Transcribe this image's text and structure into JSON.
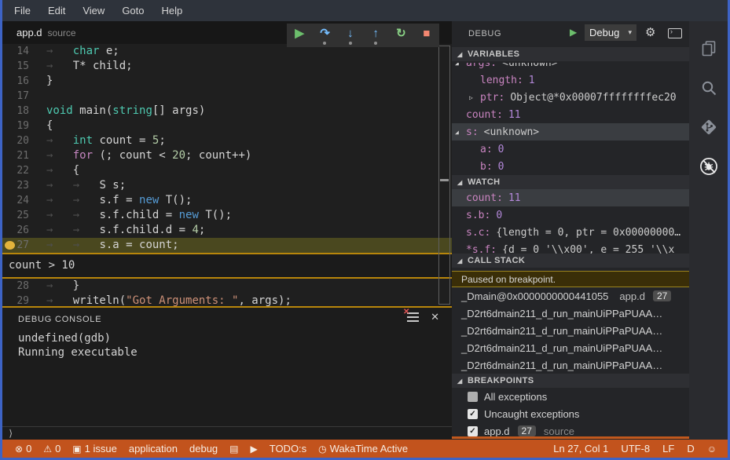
{
  "colors": {
    "window_border": "#3D63C5",
    "statusbar_bg": "#C2531D",
    "accent_orange": "#B8860B",
    "breakpoint_gold": "#E3B33C",
    "line_highlight_bg": "#4A481F",
    "keyword_type": "#4EC9B0",
    "keyword_control": "#C586C0",
    "keyword_new": "#569CD6",
    "number": "#B5CEA8",
    "string": "#CE9178",
    "variable_name": "#C984C0",
    "variable_number": "#B388D9"
  },
  "icons": {
    "expanded": "◢",
    "collapsed": "▷",
    "dropdown": "▾",
    "gear": "⚙",
    "close": "✕",
    "clear_x": "✕",
    "play": "▶",
    "prompt": "⟩",
    "term_chevron": "›"
  },
  "menu": {
    "items": [
      "File",
      "Edit",
      "View",
      "Goto",
      "Help"
    ]
  },
  "tab": {
    "file": "app.d",
    "hint": "source"
  },
  "debug_toolbar": {
    "buttons": [
      {
        "name": "continue",
        "glyph": "▶",
        "color": "#6CBE6C",
        "dot": false
      },
      {
        "name": "step-over",
        "glyph": "↷",
        "color": "#75BEFF",
        "dot": true
      },
      {
        "name": "step-into",
        "glyph": "↓",
        "color": "#75BEFF",
        "dot": true
      },
      {
        "name": "step-out",
        "glyph": "↑",
        "color": "#75BEFF",
        "dot": true
      },
      {
        "name": "restart",
        "glyph": "↻",
        "color": "#89D185",
        "dot": false
      },
      {
        "name": "stop",
        "glyph": "■",
        "color": "#F48771",
        "dot": false
      }
    ]
  },
  "editor": {
    "condition": "count > 10",
    "lines": [
      {
        "num": "14",
        "segs": [
          {
            "c": "ws",
            "t": "→   "
          },
          {
            "c": "type",
            "t": "char"
          },
          {
            "c": "def",
            "t": " e;"
          }
        ]
      },
      {
        "num": "15",
        "segs": [
          {
            "c": "ws",
            "t": "→   "
          },
          {
            "c": "def",
            "t": "T* child;"
          }
        ]
      },
      {
        "num": "16",
        "segs": [
          {
            "c": "def",
            "t": "}"
          }
        ]
      },
      {
        "num": "17",
        "segs": []
      },
      {
        "num": "18",
        "segs": [
          {
            "c": "type",
            "t": "void"
          },
          {
            "c": "def",
            "t": " main("
          },
          {
            "c": "type",
            "t": "string"
          },
          {
            "c": "def",
            "t": "[] args)"
          }
        ]
      },
      {
        "num": "19",
        "segs": [
          {
            "c": "def",
            "t": "{"
          }
        ]
      },
      {
        "num": "20",
        "segs": [
          {
            "c": "ws",
            "t": "→   "
          },
          {
            "c": "type",
            "t": "int"
          },
          {
            "c": "def",
            "t": " count = "
          },
          {
            "c": "num",
            "t": "5"
          },
          {
            "c": "def",
            "t": ";"
          }
        ]
      },
      {
        "num": "21",
        "segs": [
          {
            "c": "ws",
            "t": "→   "
          },
          {
            "c": "ctrl",
            "t": "for"
          },
          {
            "c": "def",
            "t": " (; count < "
          },
          {
            "c": "num",
            "t": "20"
          },
          {
            "c": "def",
            "t": "; count++)"
          }
        ]
      },
      {
        "num": "22",
        "segs": [
          {
            "c": "ws",
            "t": "→   "
          },
          {
            "c": "def",
            "t": "{"
          }
        ]
      },
      {
        "num": "23",
        "segs": [
          {
            "c": "ws",
            "t": "→   "
          },
          {
            "c": "ws",
            "t": "→   "
          },
          {
            "c": "def",
            "t": "S s;"
          }
        ]
      },
      {
        "num": "24",
        "segs": [
          {
            "c": "ws",
            "t": "→   "
          },
          {
            "c": "ws",
            "t": "→   "
          },
          {
            "c": "def",
            "t": "s.f = "
          },
          {
            "c": "new",
            "t": "new"
          },
          {
            "c": "def",
            "t": " T();"
          }
        ]
      },
      {
        "num": "25",
        "segs": [
          {
            "c": "ws",
            "t": "→   "
          },
          {
            "c": "ws",
            "t": "→   "
          },
          {
            "c": "def",
            "t": "s.f.child = "
          },
          {
            "c": "new",
            "t": "new"
          },
          {
            "c": "def",
            "t": " T();"
          }
        ]
      },
      {
        "num": "26",
        "segs": [
          {
            "c": "ws",
            "t": "→   "
          },
          {
            "c": "ws",
            "t": "→   "
          },
          {
            "c": "def",
            "t": "s.f.child.d = "
          },
          {
            "c": "num",
            "t": "4"
          },
          {
            "c": "def",
            "t": ";"
          }
        ]
      },
      {
        "num": "27",
        "current": true,
        "breakpoint": true,
        "segs": [
          {
            "c": "ws",
            "t": "→   "
          },
          {
            "c": "ws",
            "t": "→   "
          },
          {
            "c": "def",
            "t": "s.a = count;"
          }
        ]
      },
      {
        "widget": true
      },
      {
        "num": "28",
        "segs": [
          {
            "c": "ws",
            "t": "→   "
          },
          {
            "c": "def",
            "t": "}"
          }
        ]
      },
      {
        "num": "29",
        "segs": [
          {
            "c": "ws",
            "t": "→   "
          },
          {
            "c": "def",
            "t": "writeln("
          },
          {
            "c": "str",
            "t": "\"Got Arguments: \""
          },
          {
            "c": "def",
            "t": ", args);"
          }
        ]
      }
    ]
  },
  "console": {
    "title": "DEBUG CONSOLE",
    "lines": [
      "undefined(gdb)",
      "Running executable"
    ],
    "prompt": "⟩"
  },
  "sidebar": {
    "title": "DEBUG",
    "config": "Debug",
    "variables": {
      "label": "VARIABLES",
      "rows": [
        {
          "indent": 0,
          "arrow": "expanded",
          "name": "args",
          "value": "<unknown>",
          "vtype": "text",
          "clipped": true
        },
        {
          "indent": 1,
          "name": "length",
          "value": "1",
          "vtype": "num"
        },
        {
          "indent": 1,
          "arrow": "collapsed",
          "name": "ptr",
          "value": "Object@*0x00007ffffffffec20",
          "vtype": "text"
        },
        {
          "indent": 0,
          "name": "count",
          "value": "11",
          "vtype": "num"
        },
        {
          "indent": 0,
          "arrow": "expanded",
          "name": "s",
          "value": "<unknown>",
          "vtype": "text",
          "selected": true
        },
        {
          "indent": 1,
          "name": "a",
          "value": "0",
          "vtype": "num"
        },
        {
          "indent": 1,
          "name": "b",
          "value": "0",
          "vtype": "num"
        }
      ]
    },
    "watch": {
      "label": "WATCH",
      "rows": [
        {
          "indent": 0,
          "name": "count",
          "value": "11",
          "vtype": "num",
          "selected": true
        },
        {
          "indent": 0,
          "name": "s.b",
          "value": "0",
          "vtype": "num"
        },
        {
          "indent": 0,
          "name": "s.c",
          "value": "{length = 0, ptr = 0x00000000…",
          "vtype": "text"
        },
        {
          "indent": 0,
          "name": "*s.f",
          "value": "{d = 0 '\\\\x00', e = 255 '\\\\x",
          "vtype": "text"
        }
      ]
    },
    "call_stack": {
      "label": "CALL STACK",
      "status": "Paused on breakpoint.",
      "frames": [
        {
          "name": "_Dmain@0x0000000000441055",
          "file": "app.d",
          "line": "27"
        },
        {
          "name": "_D2rt6dmain211_d_run_mainUiPPaPUAA…"
        },
        {
          "name": "_D2rt6dmain211_d_run_mainUiPPaPUAA…"
        },
        {
          "name": "_D2rt6dmain211_d_run_mainUiPPaPUAA…"
        },
        {
          "name": "_D2rt6dmain211_d_run_mainUiPPaPUAA…"
        }
      ]
    },
    "breakpoints": {
      "label": "BREAKPOINTS",
      "items": [
        {
          "checked": false,
          "label": "All exceptions"
        },
        {
          "checked": true,
          "label": "Uncaught exceptions"
        },
        {
          "checked": true,
          "label": "app.d",
          "badge": "27",
          "hint": "source"
        }
      ]
    }
  },
  "statusbar": {
    "left": [
      {
        "name": "errors",
        "glyph": "⊗",
        "text": "0"
      },
      {
        "name": "warnings",
        "glyph": "⚠",
        "text": "0"
      },
      {
        "name": "issues",
        "glyph": "▣",
        "text": "1 issue"
      },
      {
        "name": "config-application",
        "text": "application"
      },
      {
        "name": "config-debug",
        "text": "debug"
      },
      {
        "name": "todo-file",
        "glyph": "▤"
      },
      {
        "name": "run",
        "glyph": "▶"
      },
      {
        "name": "todos",
        "text": "TODO:s"
      },
      {
        "name": "wakatime",
        "glyph": "◷",
        "text": "WakaTime Active"
      }
    ],
    "right": [
      {
        "name": "cursor-position",
        "text": "Ln 27, Col 1"
      },
      {
        "name": "encoding",
        "text": "UTF-8"
      },
      {
        "name": "eol",
        "text": "LF"
      },
      {
        "name": "language-mode",
        "text": "D"
      },
      {
        "name": "feedback",
        "glyph": "☺"
      }
    ]
  }
}
